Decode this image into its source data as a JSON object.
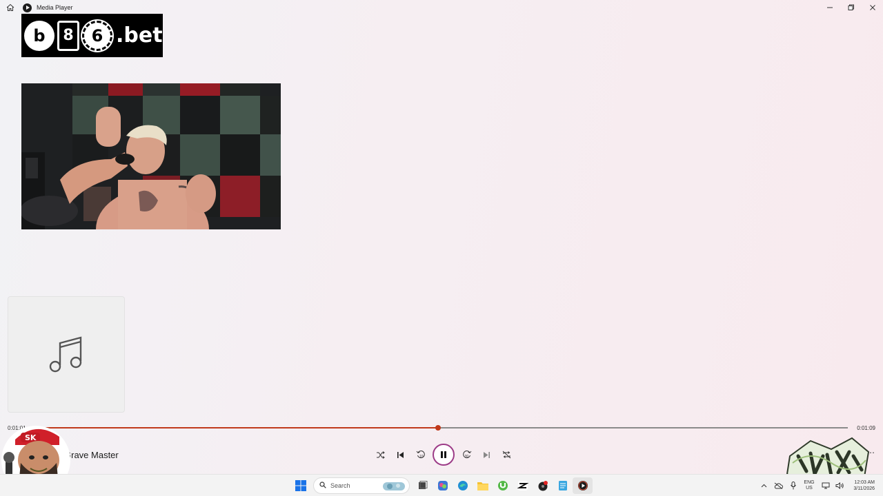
{
  "window": {
    "title": "Media Player",
    "controls": [
      "minimize",
      "maximize",
      "close"
    ]
  },
  "logo": {
    "glyph1": "b",
    "glyph2": "8",
    "glyph3": "6",
    "suffix": ".bet"
  },
  "video": {
    "description_icon": "video-thumbnail"
  },
  "album_art": {
    "icon": "music-note-icon"
  },
  "playback": {
    "current_time": "0:01:01",
    "total_time": "0:01:09",
    "progress_percent": 50,
    "song_title": "Grave Master",
    "state": "playing"
  },
  "controls": [
    {
      "name": "shuffle-button",
      "icon": "shuffle-icon"
    },
    {
      "name": "previous-button",
      "icon": "previous-icon"
    },
    {
      "name": "rewind-10-button",
      "icon": "rewind-10-icon",
      "label": "10"
    },
    {
      "name": "pause-button",
      "icon": "pause-icon"
    },
    {
      "name": "forward-30-button",
      "icon": "forward-30-icon",
      "label": "30"
    },
    {
      "name": "next-button",
      "icon": "next-icon"
    },
    {
      "name": "repeat-button",
      "icon": "repeat-icon"
    }
  ],
  "more_label": "⋯",
  "avatar": {
    "cap_text": "SK"
  },
  "taskbar": {
    "search_placeholder": "Search",
    "language": "ENG",
    "language_sub": "US",
    "time": "12:03 AM",
    "date": "3/11/2026"
  },
  "colors": {
    "accent": "#c0391b",
    "play_ring": "#9c3b87"
  }
}
